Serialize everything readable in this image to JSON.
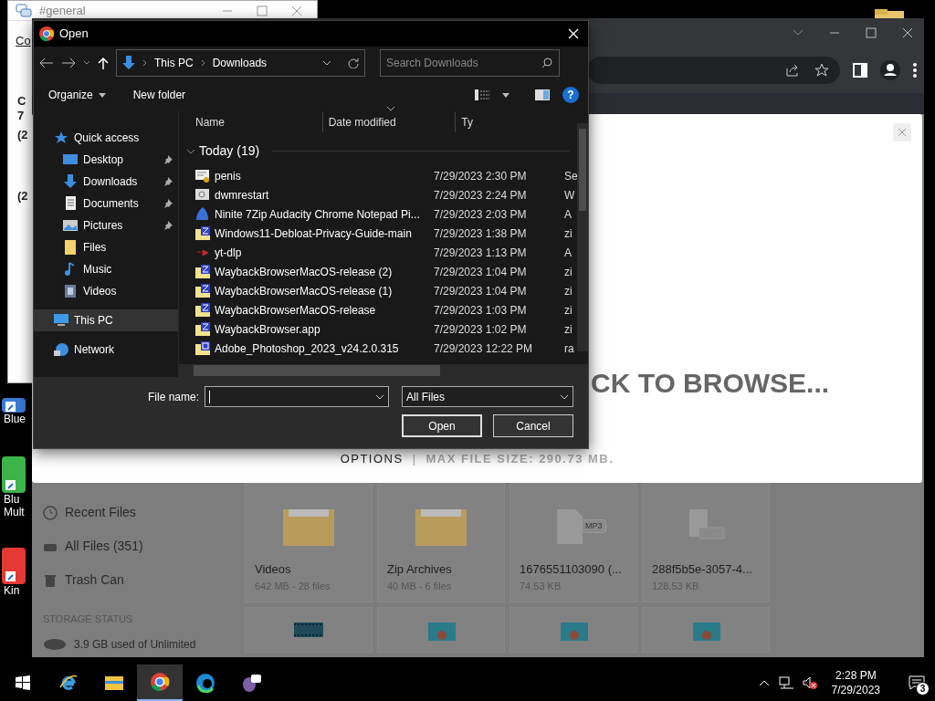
{
  "desktop_icons": [
    {
      "label": "Blue",
      "kind": "blue"
    },
    {
      "label": "Blu Mult",
      "kind": "green"
    },
    {
      "label": "Kin",
      "kind": "red"
    }
  ],
  "background_window": {
    "title": "#general",
    "fragments": [
      "Co",
      "C",
      "7",
      "(2",
      "(2"
    ]
  },
  "browser": {
    "page": {
      "sidebar": [
        {
          "label": "Recent Files",
          "kind": "clock"
        },
        {
          "label": "All Files (351)",
          "kind": "drive"
        },
        {
          "label": "Trash Can",
          "kind": "trash"
        }
      ],
      "storage_title": "STORAGE STATUS",
      "storage_text": "3.9 GB used of Unlimited",
      "cards": [
        {
          "title": "Videos",
          "meta": "642 MB - 28 files",
          "kind": "folder"
        },
        {
          "title": "Zip Archives",
          "meta": "40 MB - 6 files",
          "kind": "folder"
        },
        {
          "title": "1676551103090 (...",
          "meta": "74.53 KB",
          "kind": "mp3",
          "badge": "MP3"
        },
        {
          "title": "288f5b5e-3057-4...",
          "meta": "128.53 KB",
          "kind": "file"
        },
        {
          "kind": "video"
        },
        {
          "kind": "image"
        },
        {
          "kind": "image"
        },
        {
          "kind": "image"
        }
      ]
    },
    "modal": {
      "drop_text": "CK TO BROWSE...",
      "options": "OPTIONS",
      "separator": "|",
      "max_size": "MAX FILE SIZE: 290.73 MB."
    }
  },
  "dialog": {
    "title": "Open",
    "breadcrumb": [
      "This PC",
      "Downloads"
    ],
    "search": {
      "placeholder": "Search Downloads"
    },
    "commands": [
      "Organize",
      "New folder"
    ],
    "help": "?",
    "nav": [
      {
        "label": "Quick access",
        "kind": "star",
        "selected": false,
        "children": [
          {
            "label": "Desktop",
            "kind": "desktop",
            "pinned": true,
            "selected": false
          },
          {
            "label": "Downloads",
            "kind": "download",
            "pinned": true,
            "selected": false
          },
          {
            "label": "Documents",
            "kind": "document",
            "pinned": true,
            "selected": false
          },
          {
            "label": "Pictures",
            "kind": "picture",
            "pinned": true,
            "selected": false
          },
          {
            "label": "Files",
            "kind": "folder",
            "pinned": false,
            "selected": false
          },
          {
            "label": "Music",
            "kind": "music",
            "pinned": false,
            "selected": false
          },
          {
            "label": "Videos",
            "kind": "video",
            "pinned": false,
            "selected": false
          }
        ]
      },
      {
        "label": "This PC",
        "kind": "pc",
        "selected": true
      },
      {
        "label": "Network",
        "kind": "network",
        "selected": false
      }
    ],
    "columns": [
      {
        "label": "Name",
        "sorted": false
      },
      {
        "label": "Date modified",
        "sorted": true
      },
      {
        "label": "Ty",
        "sorted": false
      }
    ],
    "group": "Today (19)",
    "files": [
      {
        "name": "penis",
        "date": "7/29/2023 2:30 PM",
        "type": "Se",
        "kind": "cert"
      },
      {
        "name": "dwmrestart",
        "date": "7/29/2023 2:24 PM",
        "type": "W",
        "kind": "script"
      },
      {
        "name": "Ninite 7Zip Audacity Chrome Notepad Pi...",
        "date": "7/29/2023 2:03 PM",
        "type": "A",
        "kind": "ninite"
      },
      {
        "name": "Windows11-Debloat-Privacy-Guide-main",
        "date": "7/29/2023 1:38 PM",
        "type": "zi",
        "kind": "zip"
      },
      {
        "name": "yt-dlp",
        "date": "7/29/2023 1:13 PM",
        "type": "A",
        "kind": "app"
      },
      {
        "name": "WaybackBrowserMacOS-release (2)",
        "date": "7/29/2023 1:04 PM",
        "type": "zi",
        "kind": "zip"
      },
      {
        "name": "WaybackBrowserMacOS-release (1)",
        "date": "7/29/2023 1:04 PM",
        "type": "zi",
        "kind": "zip"
      },
      {
        "name": "WaybackBrowserMacOS-release",
        "date": "7/29/2023 1:03 PM",
        "type": "zi",
        "kind": "zip"
      },
      {
        "name": "WaybackBrowser.app",
        "date": "7/29/2023 1:02 PM",
        "type": "zi",
        "kind": "zip"
      },
      {
        "name": "Adobe_Photoshop_2023_v24.2.0.315",
        "date": "7/29/2023 12:22 PM",
        "type": "ra",
        "kind": "rar"
      }
    ],
    "file_name_label": "File name:",
    "filter": "All Files",
    "buttons": [
      "Open",
      "Cancel"
    ]
  },
  "taskbar": {
    "apps": [
      {
        "kind": "ie",
        "selected": false
      },
      {
        "kind": "explorer",
        "selected": false
      },
      {
        "kind": "chrome",
        "selected": true
      },
      {
        "kind": "edge",
        "selected": false
      },
      {
        "kind": "chat",
        "selected": false
      }
    ],
    "time": "2:28 PM",
    "date": "7/29/2023",
    "notifications": "3"
  }
}
